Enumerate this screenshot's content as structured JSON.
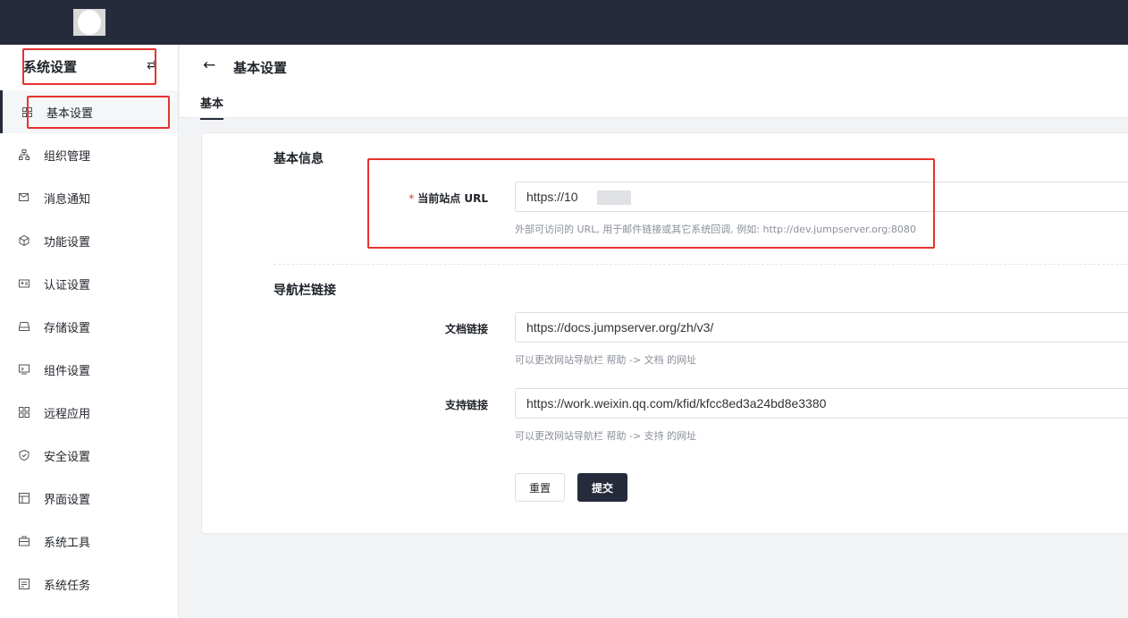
{
  "sidebar": {
    "title": "系统设置",
    "collapse_icon": "⇄",
    "items": [
      {
        "label": "基本设置",
        "icon": "grid-icon"
      },
      {
        "label": "组织管理",
        "icon": "org-tree-icon"
      },
      {
        "label": "消息通知",
        "icon": "message-icon"
      },
      {
        "label": "功能设置",
        "icon": "cube-icon"
      },
      {
        "label": "认证设置",
        "icon": "id-card-icon"
      },
      {
        "label": "存储设置",
        "icon": "storage-icon"
      },
      {
        "label": "组件设置",
        "icon": "component-icon"
      },
      {
        "label": "远程应用",
        "icon": "apps-icon"
      },
      {
        "label": "安全设置",
        "icon": "shield-icon"
      },
      {
        "label": "界面设置",
        "icon": "layout-icon"
      },
      {
        "label": "系统工具",
        "icon": "toolbox-icon"
      },
      {
        "label": "系统任务",
        "icon": "task-icon"
      }
    ]
  },
  "header": {
    "back_icon": "←",
    "title": "基本设置",
    "tabs": [
      {
        "label": "基本"
      }
    ]
  },
  "form": {
    "basic": {
      "title": "基本信息",
      "site_url": {
        "required_mark": "*",
        "label": "当前站点 URL",
        "value": "https://10         23",
        "help": "外部可访问的 URL, 用于邮件链接或其它系统回调, 例如: http://dev.jumpserver.org:8080"
      }
    },
    "nav": {
      "title": "导航栏链接",
      "docs": {
        "label": "文档链接",
        "value": "https://docs.jumpserver.org/zh/v3/",
        "help": "可以更改网站导航栏 帮助 -> 文档 的网址"
      },
      "support": {
        "label": "支持链接",
        "value": "https://work.weixin.qq.com/kfid/kfcc8ed3a24bd8e3380",
        "help": "可以更改网站导航栏 帮助 -> 支持 的网址"
      }
    },
    "reset_label": "重置",
    "submit_label": "提交"
  },
  "colors": {
    "topbar": "#262b3c",
    "accent": "#262b3c",
    "annotation": "#e8312f",
    "required": "#e8312f"
  }
}
